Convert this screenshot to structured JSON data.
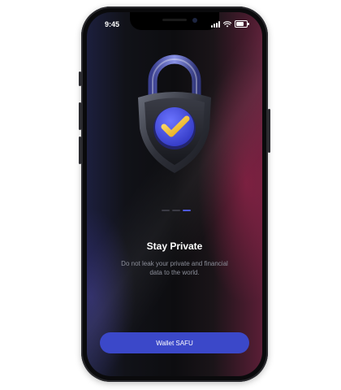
{
  "status_bar": {
    "time": "9:45",
    "signal_icon": "signal-bars-icon",
    "wifi_icon": "wifi-icon",
    "battery_icon": "battery-icon"
  },
  "illustration": {
    "icon": "padlock-shield-check-icon"
  },
  "pagination": {
    "total": 3,
    "active_index": 2
  },
  "onboarding": {
    "title": "Stay Private",
    "description": "Do not leak your private and financial data to the world."
  },
  "cta": {
    "label": "Wallet SAFU"
  },
  "colors": {
    "accent": "#3b48c9",
    "active_dot": "#4e59e0",
    "background": "#0d0d10",
    "glow_pink": "#5a1e36",
    "glow_blue": "#1c1f3d"
  }
}
